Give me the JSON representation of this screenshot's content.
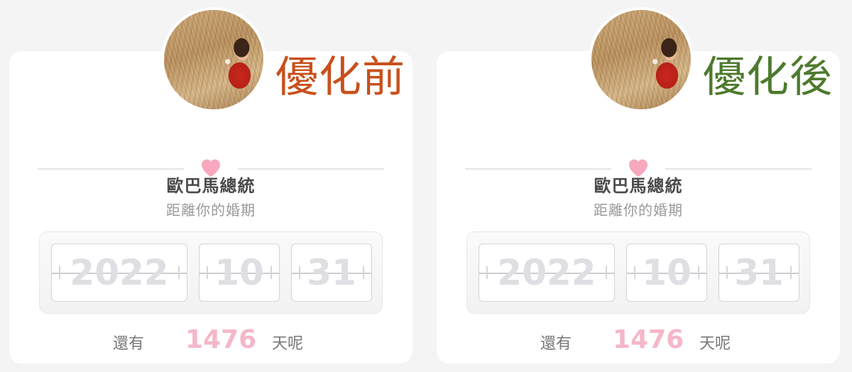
{
  "panels": [
    {
      "tag": "優化前",
      "tag_color": "#c8501c",
      "name": "歐巴馬總統",
      "subtitle": "距離你的婚期",
      "date": {
        "year": "2022",
        "month": "10",
        "day": "31"
      },
      "remaining_label": "還有",
      "remaining_count": "1476",
      "remaining_unit": "天呢"
    },
    {
      "tag": "優化後",
      "tag_color": "#4e7a2d",
      "name": "歐巴馬總統",
      "subtitle": "距離你的婚期",
      "date": {
        "year": "2022",
        "month": "10",
        "day": "31"
      },
      "remaining_label": "還有",
      "remaining_count": "1476",
      "remaining_unit": "天呢"
    }
  ],
  "icons": {
    "divider": "heart-icon",
    "avatar": "profile-photo"
  },
  "colors": {
    "heart": "#f7a8bf",
    "count": "#f5b7c8",
    "digits": "#dedfe3"
  }
}
